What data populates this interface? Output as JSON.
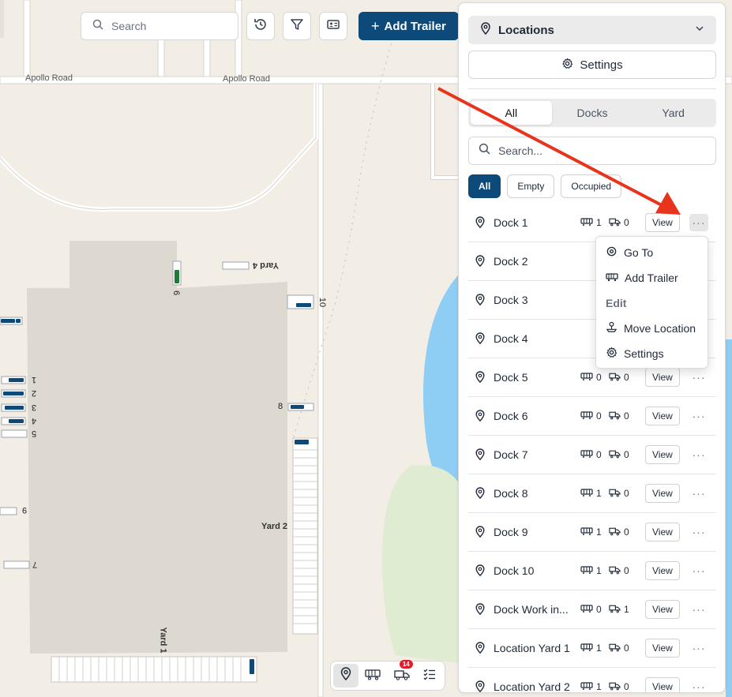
{
  "map": {
    "road_labels": [
      "Apollo Road",
      "Apollo Road"
    ],
    "yard_labels": [
      "Yard 4",
      "Yard 2",
      "Yard 1"
    ],
    "spot_numbers": [
      "9",
      "10",
      "8",
      "1",
      "2",
      "3",
      "4",
      "5",
      "6",
      "7"
    ]
  },
  "toolbar": {
    "search_placeholder": "Search",
    "add_trailer_label": "Add Trailer"
  },
  "panel": {
    "location_select": "Locations",
    "settings_label": "Settings",
    "tabs": [
      {
        "label": "All",
        "active": true
      },
      {
        "label": "Docks",
        "active": false
      },
      {
        "label": "Yard",
        "active": false
      }
    ],
    "search_placeholder": "Search...",
    "filters": [
      {
        "label": "All",
        "active": true
      },
      {
        "label": "Empty",
        "active": false
      },
      {
        "label": "Occupied",
        "active": false
      }
    ],
    "view_label": "View",
    "rows": [
      {
        "name": "Dock 1",
        "trailers": "1",
        "trucks": "0"
      },
      {
        "name": "Dock 2",
        "trailers": "",
        "trucks": ""
      },
      {
        "name": "Dock 3",
        "trailers": "",
        "trucks": ""
      },
      {
        "name": "Dock 4",
        "trailers": "",
        "trucks": ""
      },
      {
        "name": "Dock 5",
        "trailers": "0",
        "trucks": "0"
      },
      {
        "name": "Dock 6",
        "trailers": "0",
        "trucks": "0"
      },
      {
        "name": "Dock 7",
        "trailers": "0",
        "trucks": "0"
      },
      {
        "name": "Dock 8",
        "trailers": "1",
        "trucks": "0"
      },
      {
        "name": "Dock 9",
        "trailers": "1",
        "trucks": "0"
      },
      {
        "name": "Dock 10",
        "trailers": "1",
        "trucks": "0"
      },
      {
        "name": "Dock Work in...",
        "trailers": "0",
        "trucks": "1"
      },
      {
        "name": "Location Yard 1",
        "trailers": "1",
        "trucks": "0"
      },
      {
        "name": "Location Yard 2",
        "trailers": "1",
        "trucks": "0"
      }
    ]
  },
  "context_menu": {
    "go_to": "Go To",
    "add_trailer": "Add Trailer",
    "edit_heading": "Edit",
    "move_location": "Move Location",
    "settings": "Settings"
  },
  "bottom_bar": {
    "badge_count": "14"
  },
  "colors": {
    "primary": "#0d4a7a",
    "annotation_arrow": "#e8341c",
    "water": "#8ecdf4",
    "grass": "#dfecd1"
  }
}
